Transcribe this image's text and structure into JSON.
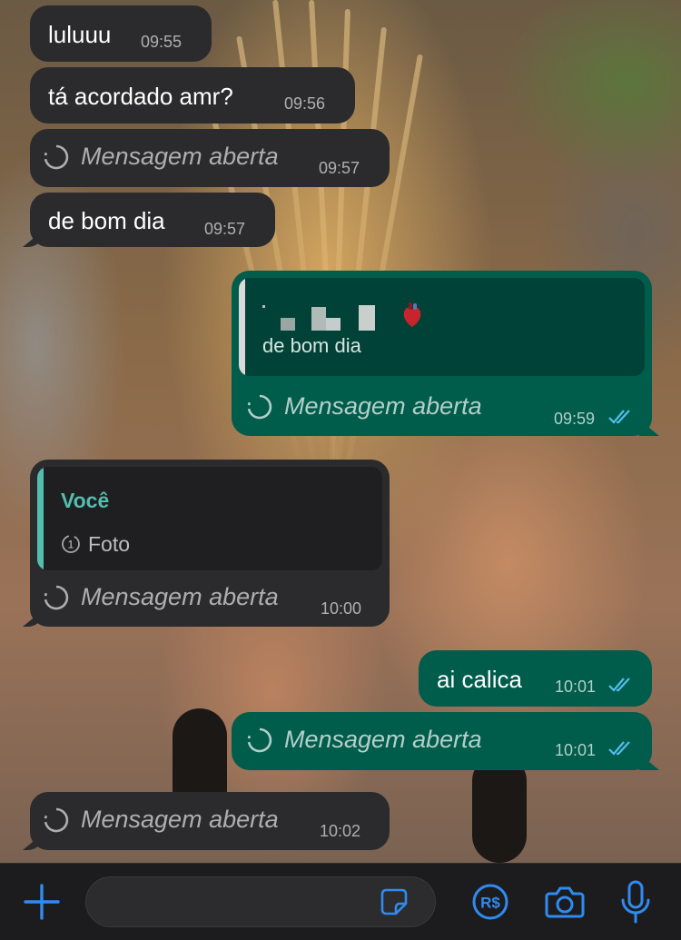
{
  "messages": [
    {
      "text": "luluuu",
      "time": "09:55"
    },
    {
      "text": "tá acordado amr?",
      "time": "09:56"
    },
    {
      "view_once": "Mensagem aberta",
      "time": "09:57"
    },
    {
      "text": "de bom dia",
      "time": "09:57"
    },
    {
      "quote_text": "de bom dia",
      "view_once": "Mensagem aberta",
      "time": "09:59"
    },
    {
      "quote_author": "Você",
      "quote_media": "Foto",
      "view_once": "Mensagem aberta",
      "time": "10:00"
    },
    {
      "text": "ai calica",
      "time": "10:01"
    },
    {
      "view_once": "Mensagem aberta",
      "time": "10:01"
    },
    {
      "view_once": "Mensagem aberta",
      "time": "10:02"
    }
  ],
  "composer": {
    "placeholder": ""
  },
  "icons": {
    "attach": "plus-icon",
    "sticker": "sticker-icon",
    "payment": "real-currency-icon",
    "camera": "camera-icon",
    "mic": "microphone-icon",
    "view_once": "view-once-icon",
    "read": "double-check-icon",
    "emoji": "anatomical-heart-emoji"
  },
  "colors": {
    "incoming_bubble": "#2b2b2d",
    "outgoing_bubble": "#005c4b",
    "quote_outgoing_bg": "#004237",
    "quote_incoming_bg": "#1f1f21",
    "accent_teal": "#53bdae",
    "read_blue": "#53bdeb",
    "action_blue": "#2f8bf0"
  }
}
